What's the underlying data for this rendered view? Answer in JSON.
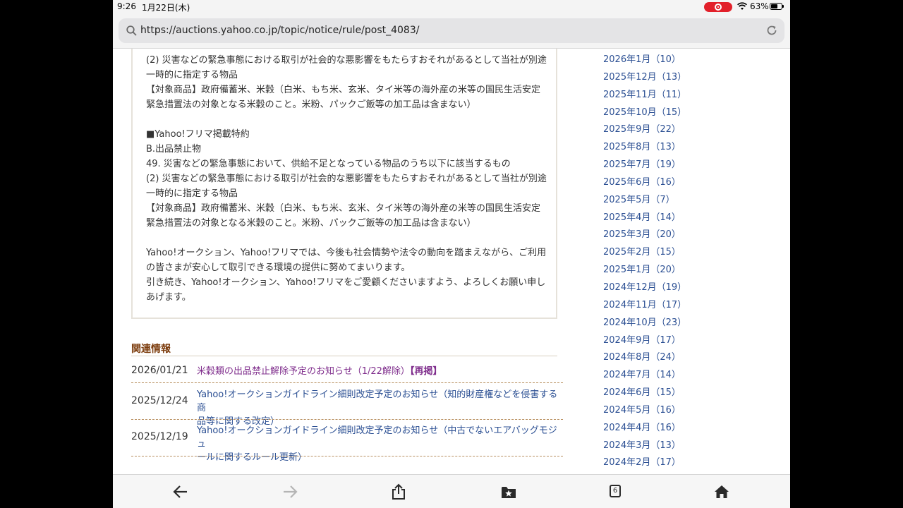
{
  "status_bar": {
    "time": "9:26",
    "date": "1月22日(木)",
    "battery_pct": "63%",
    "battery_level": 0.63
  },
  "browser": {
    "url": "https://auctions.yahoo.co.jp/topic/notice/rule/post_4083/",
    "tab_count": "6"
  },
  "article": {
    "lines": [
      "(2) 災害などの緊急事態における取引が社会的な悪影響をもたらすおそれがあるとして当社が別途",
      "一時的に指定する物品",
      "【対象商品】政府備蓄米、米穀（白米、もち米、玄米、タイ米等の海外産の米等の国民生活安定",
      "緊急措置法の対象となる米穀のこと。米粉、パックご飯等の加工品は含まない）",
      "",
      "■Yahoo!フリマ掲載特約",
      "B.出品禁止物",
      "49. 災害などの緊急事態において、供給不足となっている物品のうち以下に該当するもの",
      "(2) 災害などの緊急事態における取引が社会的な悪影響をもたらすおそれがあるとして当社が別途",
      "一時的に指定する物品",
      "【対象商品】政府備蓄米、米穀（白米、もち米、玄米、タイ米等の海外産の米等の国民生活安定",
      "緊急措置法の対象となる米穀のこと。米粉、パックご飯等の加工品は含まない）",
      "",
      "Yahoo!オークション、Yahoo!フリマでは、今後も社会情勢や法令の動向を踏まえながら、ご利用",
      "の皆さまが安心して取引できる環境の提供に努めてまいります。",
      "引き続き、Yahoo!オークション、Yahoo!フリマをご愛顧くださいますよう、よろしくお願い申し",
      "あげます。"
    ]
  },
  "related": {
    "heading": "関連情報",
    "items": [
      {
        "date": "2026/01/21",
        "title": "米穀類の出品禁止解除予定のお知らせ（1/22解除）",
        "tag": "【再掲】",
        "visited": true
      },
      {
        "date": "2025/12/24",
        "title_line1": "Yahoo!オークションガイドライン細則改定予定のお知らせ（知的財産権などを侵害する商",
        "title_line2": "品等に関する改定）",
        "visited": false
      },
      {
        "date": "2025/12/19",
        "title_line1": "Yahoo!オークションガイドライン細則改定予定のお知らせ（中古でないエアバッグモジュ",
        "title_line2": "ールに関するルール更新）",
        "visited": false
      }
    ]
  },
  "archive": [
    "2026年1月（10）",
    "2025年12月（13）",
    "2025年11月（11）",
    "2025年10月（15）",
    "2025年9月（22）",
    "2025年8月（13）",
    "2025年7月（19）",
    "2025年6月（16）",
    "2025年5月（7）",
    "2025年4月（14）",
    "2025年3月（20）",
    "2025年2月（15）",
    "2025年1月（20）",
    "2024年12月（19）",
    "2024年11月（17）",
    "2024年10月（23）",
    "2024年9月（17）",
    "2024年8月（24）",
    "2024年7月（14）",
    "2024年6月（15）",
    "2024年5月（16）",
    "2024年4月（16）",
    "2024年3月（13）",
    "2024年2月（17）"
  ],
  "icons": {
    "search": "search-icon",
    "reload": "reload-icon",
    "back": "back-arrow-icon",
    "forward": "forward-arrow-icon",
    "share": "share-icon",
    "bookmarks": "bookmarks-icon",
    "tabs": "tabs-icon",
    "home": "home-icon"
  },
  "colors": {
    "link": "#2b4f93",
    "visited_link": "#7f2d8c",
    "heading": "#7c3c0d",
    "record_indicator": "#e2202a"
  }
}
